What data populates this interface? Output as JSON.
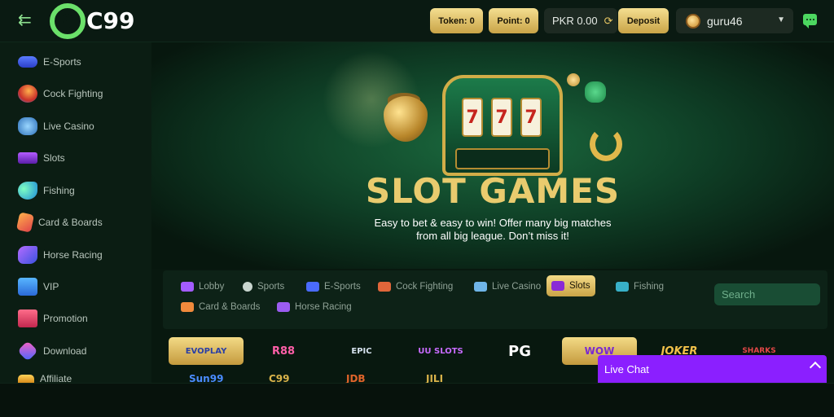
{
  "header": {
    "logo_text": "9C99",
    "token_label": "Token: 0",
    "point_label": "Point: 0",
    "balance": "PKR 0.00",
    "deposit_label": "Deposit",
    "username": "guru46",
    "icons": [
      "back-arrow-icon",
      "refresh-icon",
      "chat-icon",
      "chevron-down-icon"
    ]
  },
  "sidebar": {
    "items": [
      {
        "label": "E-Sports",
        "icon": "gamepad-icon"
      },
      {
        "label": "Cock Fighting",
        "icon": "rooster-icon"
      },
      {
        "label": "Live Casino",
        "icon": "chips-icon"
      },
      {
        "label": "Slots",
        "icon": "slot-machine-icon"
      },
      {
        "label": "Fishing",
        "icon": "fish-icon"
      },
      {
        "label": "Card & Boards",
        "icon": "cards-icon"
      },
      {
        "label": "Horse Racing",
        "icon": "horse-icon"
      },
      {
        "label": "VIP",
        "icon": "vip-icon"
      },
      {
        "label": "Promotion",
        "icon": "gift-icon"
      },
      {
        "label": "Download",
        "icon": "download-icon"
      },
      {
        "label": "Affiliate",
        "icon": "crown-icon"
      }
    ]
  },
  "banner": {
    "title": "SLOT GAMES",
    "subtitle_line1": "Easy to bet & easy to win! Offer many big matches",
    "subtitle_line2": "from all big league. Don’t miss it!",
    "reel_symbol": "7"
  },
  "tabs": [
    {
      "label": "Lobby",
      "active": false
    },
    {
      "label": "Sports",
      "active": false
    },
    {
      "label": "E-Sports",
      "active": false
    },
    {
      "label": "Cock Fighting",
      "active": false
    },
    {
      "label": "Live Casino",
      "active": false
    },
    {
      "label": "Slots",
      "active": true
    },
    {
      "label": "Fishing",
      "active": false
    },
    {
      "label": "Card & Boards",
      "active": false
    },
    {
      "label": "Horse Racing",
      "active": false
    }
  ],
  "search": {
    "placeholder": "Search"
  },
  "providers": [
    "EVOPLAY",
    "R88",
    "EPIC",
    "UU SLOTS",
    "PG",
    "WOW",
    "JOKER",
    "SHARKS"
  ],
  "providers_row2": [
    "Sun99",
    "C99",
    "JDB",
    "JILI"
  ],
  "live_chat": {
    "label": "Live Chat"
  },
  "colors": {
    "accent_gold": "#e9cb6e",
    "active_tab_bg": "#f3da86",
    "live_chat_bg": "#8b1fff",
    "background": "#06140c"
  }
}
